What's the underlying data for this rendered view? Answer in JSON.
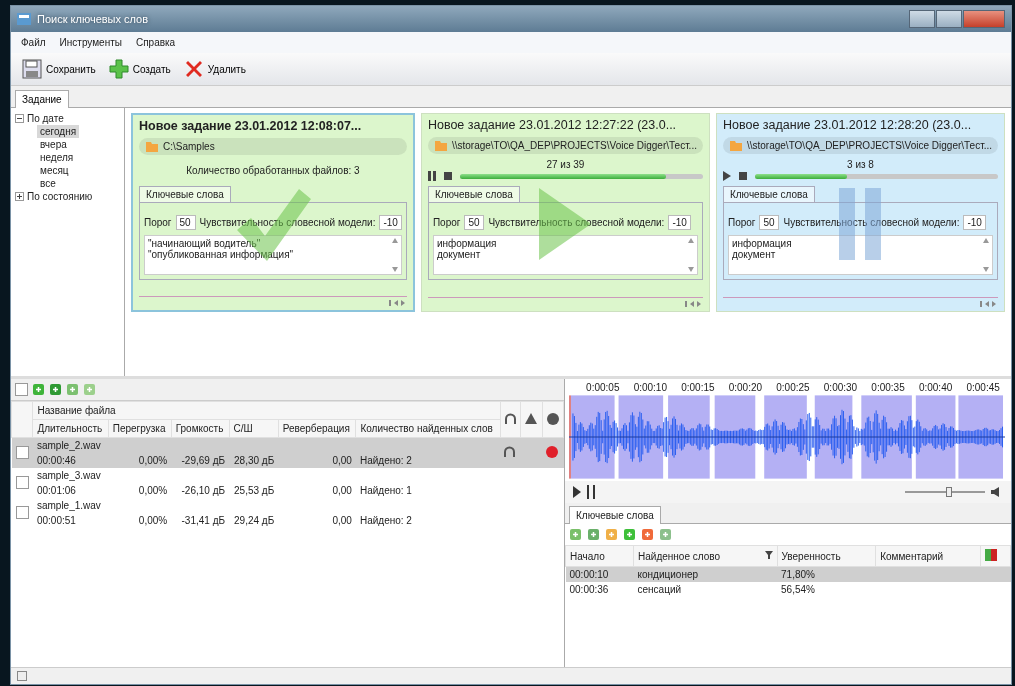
{
  "window": {
    "title": "Поиск ключевых слов"
  },
  "menu": [
    "Файл",
    "Инструменты",
    "Справка"
  ],
  "toolbar": [
    {
      "kind": "save",
      "label": "Сохранить"
    },
    {
      "kind": "create",
      "label": "Создать"
    },
    {
      "kind": "delete",
      "label": "Удалить"
    }
  ],
  "tabs": [
    {
      "label": "Задание",
      "selected": true
    }
  ],
  "tree": [
    {
      "label": "По дате",
      "expanded": true,
      "children": [
        {
          "label": "сегодня",
          "selected": true
        },
        {
          "label": "вчера",
          "selected": false
        },
        {
          "label": "неделя",
          "selected": false
        },
        {
          "label": "месяц",
          "selected": false
        },
        {
          "label": "все",
          "selected": false
        }
      ]
    },
    {
      "label": "По состоянию",
      "expanded": false
    }
  ],
  "cards": [
    {
      "title": "Новое задание 23.01.2012 12:08:07...",
      "selected": true,
      "kind": "done",
      "path": "C:\\Samples",
      "info": "Количество обработанных файлов: 3",
      "tab": "Ключевые слова",
      "threshold_label": "Порог",
      "threshold": "50",
      "sensitivity_label": "Чувствительность словесной модели:",
      "sensitivity": "-10",
      "keywords": [
        "\"начинающий водитель\"",
        "\"опубликованная информация\""
      ]
    },
    {
      "title": "Новое задание 23.01.2012 12:27:22 (23.0...",
      "selected": false,
      "kind": "running",
      "path": "\\\\storage\\TO\\QA_DEP\\PROJECTS\\Voice Digger\\Тест...",
      "progress": {
        "label": "27 из 39",
        "level": 0.85
      },
      "tab": "Ключевые слова",
      "threshold_label": "Порог",
      "threshold": "50",
      "sensitivity_label": "Чувствительность словесной модели:",
      "sensitivity": "-10",
      "keywords": [
        "информация",
        "документ"
      ]
    },
    {
      "title": "Новое задание 23.01.2012 12:28:20 (23.0...",
      "selected": false,
      "kind": "paused",
      "path": "\\\\storage\\TO\\QA_DEP\\PROJECTS\\Voice Digger\\Тест...",
      "progress": {
        "label": "3 из 8",
        "level": 0.38
      },
      "tab": "Ключевые слова",
      "threshold_label": "Порог",
      "threshold": "50",
      "sensitivity_label": "Чувствительность словесной модели:",
      "sensitivity": "-10",
      "keywords": [
        "информация",
        "документ"
      ]
    }
  ],
  "files": {
    "select_all": {
      "checked": false
    },
    "name_header": "Название файла",
    "columns": [
      "Длительность",
      "Перегрузка",
      "Громкость",
      "С/Ш",
      "Реверберация",
      "Количество найденных слов"
    ],
    "rows": [
      {
        "name": "sample_2.wav",
        "selected": true,
        "checked": false,
        "listened": true,
        "error": true,
        "values": [
          "00:00:46",
          "0,00%",
          "-29,69 дБ",
          "28,30 дБ",
          "0,00",
          "Найдено: 2"
        ]
      },
      {
        "name": "sample_3.wav",
        "selected": false,
        "checked": false,
        "listened": false,
        "error": false,
        "values": [
          "00:01:06",
          "0,00%",
          "-26,10 дБ",
          "25,53 дБ",
          "0,00",
          "Найдено: 1"
        ]
      },
      {
        "name": "sample_1.wav",
        "selected": false,
        "checked": false,
        "listened": false,
        "error": false,
        "values": [
          "00:00:51",
          "0,00%",
          "-31,41 дБ",
          "29,24 дБ",
          "0,00",
          "Найдено: 2"
        ]
      }
    ]
  },
  "waveform": {
    "ticks": [
      "0:00:05",
      "0:00:10",
      "0:00:15",
      "0:00:20",
      "0:00:25",
      "0:00:30",
      "0:00:35",
      "0:00:40",
      "0:00:45"
    ],
    "zoom": {
      "level": 0.55
    }
  },
  "keywords_panel": {
    "tab": "Ключевые слова",
    "columns": [
      "Начало",
      "Найденное слово",
      "Уверенность",
      "Комментарий"
    ],
    "rows": [
      {
        "start": "00:00:10",
        "word": "кондиционер",
        "confidence": "71,80%",
        "selected": true
      },
      {
        "start": "00:00:36",
        "word": "сенсаций",
        "confidence": "56,54%",
        "selected": false
      }
    ]
  }
}
